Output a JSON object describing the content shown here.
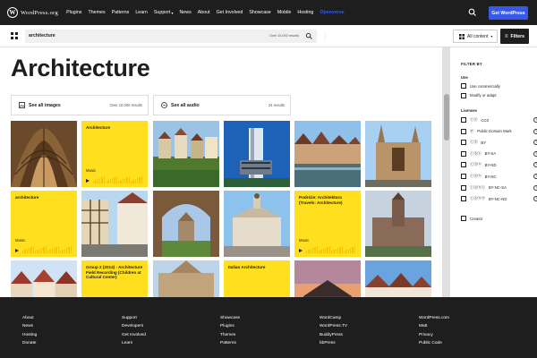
{
  "topnav": {
    "logo_text": "WordPress.org",
    "menu": [
      "Plugins",
      "Themes",
      "Patterns",
      "Learn",
      "Support",
      "News",
      "About",
      "Get Involved",
      "Showcase",
      "Mobile",
      "Hosting",
      "Openverse"
    ],
    "cta": "Get WordPress",
    "accent": "#3858e9"
  },
  "search": {
    "value": "architecture",
    "results": "Over 10,000 results",
    "content_type": "All content",
    "filters_label": "Filters"
  },
  "main": {
    "title": "Architecture",
    "all_images": {
      "label": "See all images",
      "count": "Over 10,000 results"
    },
    "all_audio": {
      "label": "See all audio",
      "count": "24 results"
    }
  },
  "tiles": [
    {
      "kind": "image",
      "scene": "vault"
    },
    {
      "kind": "audio",
      "title": "Architecture",
      "music": "Music"
    },
    {
      "kind": "image",
      "scene": "village"
    },
    {
      "kind": "image",
      "scene": "tower"
    },
    {
      "kind": "image",
      "scene": "riverside"
    },
    {
      "kind": "image",
      "scene": "cathedral"
    },
    {
      "kind": "audio",
      "title": "architecture",
      "music": "Music"
    },
    {
      "kind": "image",
      "scene": "timber-street"
    },
    {
      "kind": "image",
      "scene": "arch"
    },
    {
      "kind": "image",
      "scene": "palace"
    },
    {
      "kind": "audio",
      "title": "Podróże: Architektura (Travels: Architecture)",
      "music": "Music"
    },
    {
      "kind": "image",
      "scene": "church-tower"
    },
    {
      "kind": "image",
      "scene": "row-houses"
    },
    {
      "kind": "audio",
      "title": "Group 2 (2014) - Architecture Field Recording (Children at Cultural Center)",
      "music": ""
    },
    {
      "kind": "image",
      "scene": "gothic-facade"
    },
    {
      "kind": "audio",
      "title": "Italian Architecture",
      "music": ""
    },
    {
      "kind": "image",
      "scene": "sunset"
    },
    {
      "kind": "image",
      "scene": "square"
    }
  ],
  "sidebar": {
    "title": "FILTER BY",
    "use_heading": "Use",
    "use_options": [
      "Use commercially",
      "Modify or adapt"
    ],
    "licenses_heading": "Licenses",
    "licenses": [
      {
        "icons": "ⓒⓞ",
        "label": "CC0"
      },
      {
        "icons": "ⓟ",
        "label": "Public Domain Mark"
      },
      {
        "icons": "ⓒⓑ",
        "label": "BY"
      },
      {
        "icons": "ⓒⓑⓢ",
        "label": "BY-SA"
      },
      {
        "icons": "ⓒⓑⓝ",
        "label": "BY-ND"
      },
      {
        "icons": "ⓒⓑⓝ",
        "label": "BY-NC"
      },
      {
        "icons": "ⓒⓑⓝⓢ",
        "label": "BY-NC-SA"
      },
      {
        "icons": "ⓒⓑⓝⓝ",
        "label": "BY-NC-ND"
      }
    ],
    "creator_option": "Creator"
  },
  "footer": {
    "columns": [
      [
        "About",
        "News",
        "Hosting",
        "Donate"
      ],
      [
        "Support",
        "Developers",
        "Get Involved",
        "Learn"
      ],
      [
        "Showcase",
        "Plugins",
        "Themes",
        "Patterns"
      ],
      [
        "WordCamp",
        "WordPress.TV",
        "BuddyPress",
        "bbPress"
      ],
      [
        "WordPress.com",
        "Matt",
        "Privacy",
        "Public Code"
      ]
    ]
  }
}
